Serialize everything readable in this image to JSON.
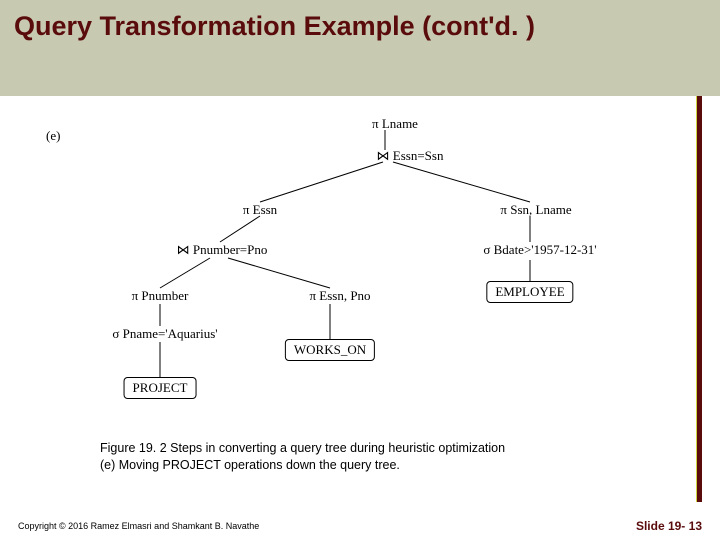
{
  "title": "Query Transformation Example (cont'd. )",
  "sublabel": "(e)",
  "nodes": {
    "root": "π Lname",
    "join_top": "⋈ Essn=Ssn",
    "proj_essn": "π Essn",
    "proj_ssn_ln": "π Ssn, Lname",
    "join_mid": "⋈ Pnumber=Pno",
    "sel_bdate": "σ Bdate>'1957-12-31'",
    "proj_pnum": "π Pnumber",
    "proj_ep": "π Essn, Pno",
    "sel_pname": "σ Pname='Aquarius'",
    "leaf_emp": "EMPLOYEE",
    "leaf_wo": "WORKS_ON",
    "leaf_proj": "PROJECT"
  },
  "caption_line1": "Figure 19. 2 Steps in converting a query tree during heuristic optimization",
  "caption_line2": "(e) Moving PROJECT operations down the query tree.",
  "copyright": "Copyright © 2016 Ramez Elmasri and Shamkant B. Navathe",
  "slide": "Slide 19- 13",
  "chart_data": {
    "type": "table",
    "description": "Relational-algebra query tree (step e of Figure 19.2). Edges listed parent → child.",
    "nodes": [
      {
        "id": "root",
        "label": "π Lname"
      },
      {
        "id": "join_top",
        "label": "⋈ Essn=Ssn"
      },
      {
        "id": "proj_essn",
        "label": "π Essn"
      },
      {
        "id": "proj_ssn_ln",
        "label": "π Ssn, Lname"
      },
      {
        "id": "join_mid",
        "label": "⋈ Pnumber=Pno"
      },
      {
        "id": "sel_bdate",
        "label": "σ Bdate>'1957-12-31'"
      },
      {
        "id": "proj_pnum",
        "label": "π Pnumber"
      },
      {
        "id": "proj_ep",
        "label": "π Essn, Pno"
      },
      {
        "id": "sel_pname",
        "label": "σ Pname='Aquarius'"
      },
      {
        "id": "leaf_emp",
        "label": "EMPLOYEE"
      },
      {
        "id": "leaf_wo",
        "label": "WORKS_ON"
      },
      {
        "id": "leaf_proj",
        "label": "PROJECT"
      }
    ],
    "edges": [
      [
        "root",
        "join_top"
      ],
      [
        "join_top",
        "proj_essn"
      ],
      [
        "join_top",
        "proj_ssn_ln"
      ],
      [
        "proj_essn",
        "join_mid"
      ],
      [
        "proj_ssn_ln",
        "sel_bdate"
      ],
      [
        "sel_bdate",
        "leaf_emp"
      ],
      [
        "join_mid",
        "proj_pnum"
      ],
      [
        "join_mid",
        "proj_ep"
      ],
      [
        "proj_pnum",
        "sel_pname"
      ],
      [
        "sel_pname",
        "leaf_proj"
      ],
      [
        "proj_ep",
        "leaf_wo"
      ]
    ]
  }
}
